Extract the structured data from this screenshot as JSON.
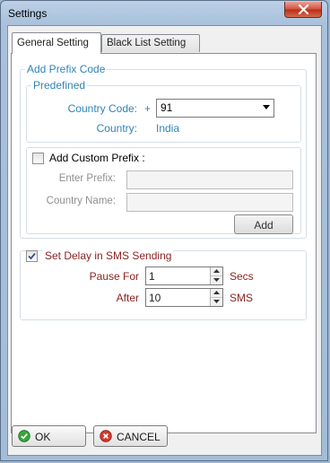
{
  "window": {
    "title": "Settings"
  },
  "tabs": [
    {
      "label": "General Setting",
      "active": true
    },
    {
      "label": "Black List Setting",
      "active": false
    }
  ],
  "prefix": {
    "group_title": "Add Prefix Code",
    "predefined_title": "Predefined",
    "country_code_label": "Country Code:",
    "plus_sign": "+",
    "country_code_value": "91",
    "country_label": "Country:",
    "country_value": "India"
  },
  "custom": {
    "checkbox_label": "Add Custom Prefix :",
    "checked": false,
    "enter_prefix_label": "Enter Prefix:",
    "enter_prefix_value": "",
    "country_name_label": "Country Name:",
    "country_name_value": "",
    "add_button": "Add"
  },
  "delay": {
    "checkbox_label": "Set Delay in SMS Sending",
    "checked": true,
    "pause_label": "Pause For",
    "pause_value": "1",
    "pause_unit": "Secs",
    "after_label": "After",
    "after_value": "10",
    "after_unit": "SMS"
  },
  "footer": {
    "ok": "OK",
    "cancel": "CANCEL"
  },
  "colors": {
    "accent": "#2e84b5",
    "delay_text": "#8a2321",
    "close_red": "#c4422b"
  }
}
